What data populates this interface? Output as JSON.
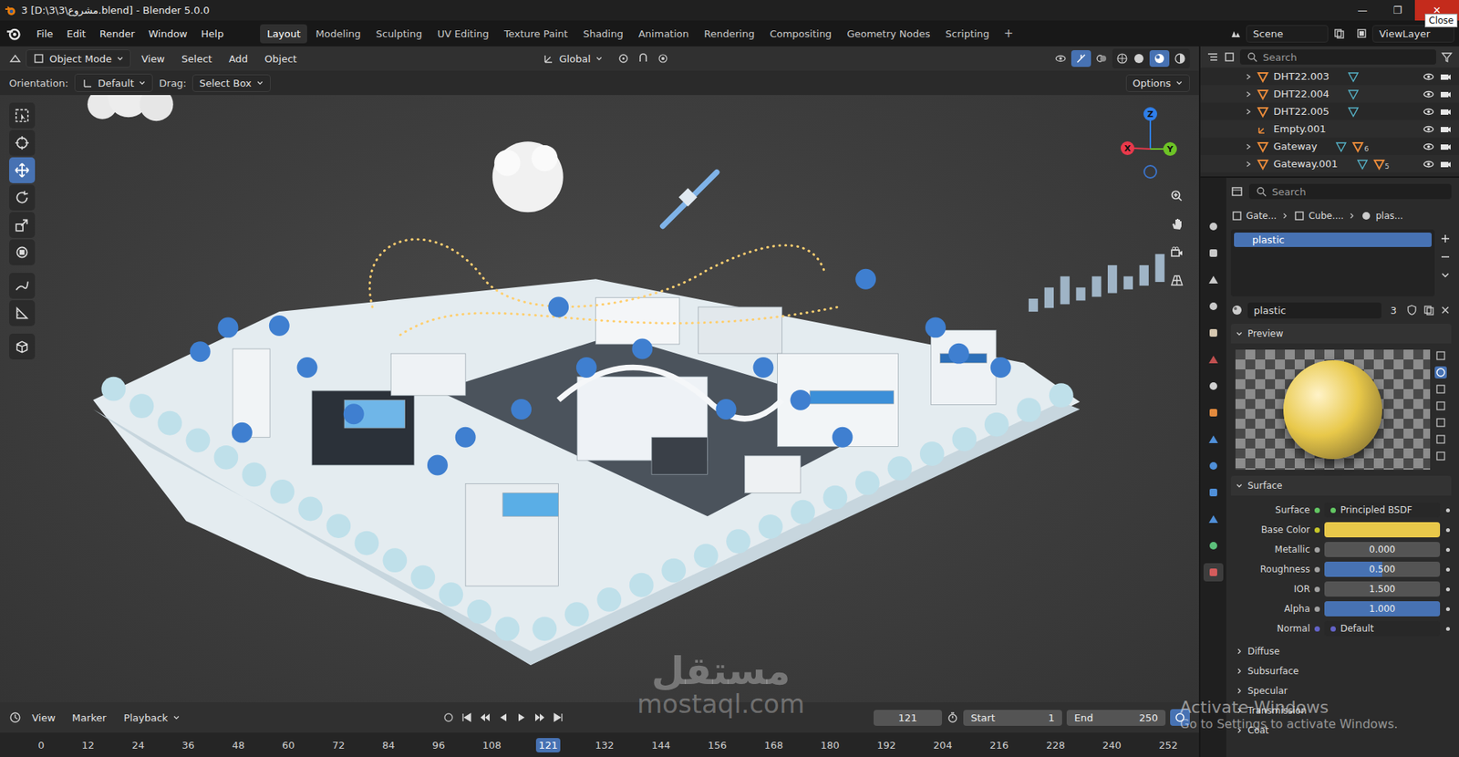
{
  "window": {
    "title": "3 [D:\\3\\مشروع\\3.blend] - Blender 5.0.0",
    "controls": [
      "—",
      "❐",
      "✕"
    ],
    "tooltip": "Close"
  },
  "menu": [
    "File",
    "Edit",
    "Render",
    "Window",
    "Help"
  ],
  "workspaces": [
    {
      "label": "Layout",
      "selected": true
    },
    {
      "label": "Modeling",
      "selected": false
    },
    {
      "label": "Sculpting",
      "selected": false
    },
    {
      "label": "UV Editing",
      "selected": false
    },
    {
      "label": "Texture Paint",
      "selected": false
    },
    {
      "label": "Shading",
      "selected": false
    },
    {
      "label": "Animation",
      "selected": false
    },
    {
      "label": "Rendering",
      "selected": false
    },
    {
      "label": "Compositing",
      "selected": false
    },
    {
      "label": "Geometry Nodes",
      "selected": false
    },
    {
      "label": "Scripting",
      "selected": false
    }
  ],
  "add_workspace": "+",
  "scene": "Scene",
  "view_layer": "ViewLayer",
  "viewport": {
    "mode": "Object Mode",
    "menus": [
      "View",
      "Select",
      "Add",
      "Object"
    ],
    "transform": "Global",
    "orientation_label": "Orientation:",
    "orientation": "Default",
    "drag_label": "Drag:",
    "drag": "Select Box",
    "options": "Options",
    "tools": [
      {
        "selected": false
      },
      {
        "selected": false
      },
      {
        "selected": true
      },
      {
        "selected": false
      },
      {
        "selected": false
      },
      {
        "selected": false
      },
      {
        "selected": false
      },
      {
        "selected": false
      },
      {
        "selected": false
      }
    ],
    "gizmo": [
      {
        "label": "Z",
        "color": "#2f7ee8"
      },
      {
        "label": "X",
        "color": "#e8394b"
      },
      {
        "label": "Y",
        "color": "#6dc326"
      }
    ]
  },
  "timeline": {
    "menus": [
      "View",
      "Marker"
    ],
    "playback": "Playback",
    "frame": "121",
    "start_label": "Start",
    "start": "1",
    "end_label": "End",
    "end": "250",
    "ruler": [
      {
        "label": "0",
        "selected": false
      },
      {
        "label": "12",
        "selected": false
      },
      {
        "label": "24",
        "selected": false
      },
      {
        "label": "36",
        "selected": false
      },
      {
        "label": "48",
        "selected": false
      },
      {
        "label": "60",
        "selected": false
      },
      {
        "label": "72",
        "selected": false
      },
      {
        "label": "84",
        "selected": false
      },
      {
        "label": "96",
        "selected": false
      },
      {
        "label": "108",
        "selected": false
      },
      {
        "label": "121",
        "selected": true
      },
      {
        "label": "132",
        "selected": false
      },
      {
        "label": "144",
        "selected": false
      },
      {
        "label": "156",
        "selected": false
      },
      {
        "label": "168",
        "selected": false
      },
      {
        "label": "180",
        "selected": false
      },
      {
        "label": "192",
        "selected": false
      },
      {
        "label": "204",
        "selected": false
      },
      {
        "label": "216",
        "selected": false
      },
      {
        "label": "228",
        "selected": false
      },
      {
        "label": "240",
        "selected": false
      },
      {
        "label": "252",
        "selected": false
      }
    ]
  },
  "outliner": {
    "search": "Search",
    "rows": [
      {
        "name": "DHT22.003",
        "kind": "mesh",
        "expandable": true,
        "count": ""
      },
      {
        "name": "DHT22.004",
        "kind": "mesh",
        "expandable": true,
        "count": ""
      },
      {
        "name": "DHT22.005",
        "kind": "mesh",
        "expandable": true,
        "count": ""
      },
      {
        "name": "Empty.001",
        "kind": "empty",
        "expandable": false,
        "count": ""
      },
      {
        "name": "Gateway",
        "kind": "mesh",
        "expandable": true,
        "count": "6"
      },
      {
        "name": "Gateway.001",
        "kind": "mesh",
        "expandable": true,
        "count": "5"
      }
    ]
  },
  "properties": {
    "search": "Search",
    "tabs": [
      {
        "selected": false
      },
      {
        "selected": false
      },
      {
        "selected": false
      },
      {
        "selected": false
      },
      {
        "selected": false
      },
      {
        "selected": false
      },
      {
        "selected": false
      },
      {
        "selected": false
      },
      {
        "selected": false
      },
      {
        "selected": false
      },
      {
        "selected": false
      },
      {
        "selected": false
      },
      {
        "selected": false
      },
      {
        "selected": true
      }
    ],
    "breadcrumb": [
      "Gate...",
      "Cube....",
      "plas..."
    ],
    "slots": [
      {
        "name": "plastic",
        "selected": true
      }
    ],
    "material": "plastic",
    "users": "3",
    "preview": "Preview",
    "surface": "Surface",
    "rows": [
      {
        "kind": "link",
        "label": "Surface",
        "value": "Principled BSDF"
      },
      {
        "kind": "color",
        "label": "Base Color",
        "color": "#e8c84a"
      },
      {
        "kind": "slider",
        "label": "Metallic",
        "value": "0.000",
        "level": 0
      },
      {
        "kind": "slider",
        "label": "Roughness",
        "value": "0.500",
        "level": 0.5
      },
      {
        "kind": "number",
        "label": "IOR",
        "value": "1.500"
      },
      {
        "kind": "slider",
        "label": "Alpha",
        "value": "1.000",
        "level": 1
      },
      {
        "kind": "vector",
        "label": "Normal",
        "value": "Default"
      }
    ],
    "subpanels": [
      "Diffuse",
      "Subsurface",
      "Specular",
      "Transmission",
      "Coat"
    ]
  },
  "watermark": {
    "arabic": "مستقل",
    "latin": "mostaql.com"
  },
  "activation": {
    "title": "Activate Windows",
    "text": "Go to Settings to activate Windows."
  }
}
